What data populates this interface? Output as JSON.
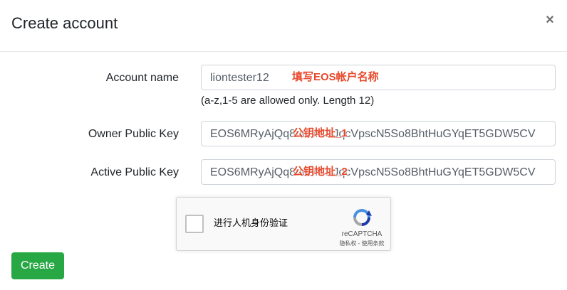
{
  "modal": {
    "title": "Create account",
    "close_symbol": "×"
  },
  "form": {
    "account_name": {
      "label": "Account name",
      "value": "liontester12",
      "annotation": "填写EOS帐户名称",
      "help": "(a-z,1-5 are allowed only. Length 12)"
    },
    "owner_key": {
      "label": "Owner Public Key",
      "value": "EOS6MRyAjQq8udMVPJqcVpscN5So8BhtHuGYqET5GDW5CV",
      "annotation": "公钥地址_1"
    },
    "active_key": {
      "label": "Active Public Key",
      "value": "EOS6MRyAjQq8udMVPJqcVpscN5So8BhtHuGYqET5GDW5CV",
      "annotation": "公钥地址_2"
    }
  },
  "captcha": {
    "text": "进行人机身份验证",
    "brand": "reCAPTCHA",
    "terms": "隐私权 - 使用条款",
    "icon": "recaptcha-logo"
  },
  "actions": {
    "create_label": "Create",
    "create_color": "#28a745"
  },
  "colors": {
    "annotation": "#e8472a"
  }
}
